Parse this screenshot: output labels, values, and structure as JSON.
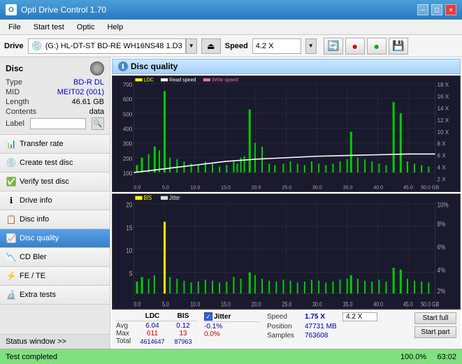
{
  "titlebar": {
    "title": "Opti Drive Control 1.70",
    "minimize": "—",
    "maximize": "□",
    "close": "✕"
  },
  "menubar": {
    "items": [
      "File",
      "Start test",
      "Optic",
      "Help"
    ]
  },
  "drivebar": {
    "label": "Drive",
    "drive_name": "(G:)  HL-DT-ST BD-RE  WH16NS48 1.D3",
    "speed_label": "Speed",
    "speed_value": "4.2 X"
  },
  "disc": {
    "label": "Disc",
    "type_key": "Type",
    "type_val": "BD-R DL",
    "mid_key": "MID",
    "mid_val": "MEIT02 (001)",
    "length_key": "Length",
    "length_val": "46.61 GB",
    "contents_key": "Contents",
    "contents_val": "data",
    "label_key": "Label",
    "label_val": ""
  },
  "nav": {
    "items": [
      "Transfer rate",
      "Create test disc",
      "Verify test disc",
      "Drive info",
      "Disc info",
      "Disc quality",
      "CD Bler",
      "FE / TE",
      "Extra tests"
    ],
    "active": "Disc quality"
  },
  "status_window": "Status window >>",
  "chart": {
    "title": "Disc quality",
    "legend": {
      "ldc": "LDC",
      "read_speed": "Read speed",
      "write_speed": "Write speed",
      "bis": "BIS",
      "jitter": "Jitter"
    },
    "top_chart": {
      "y_max": 700,
      "y_labels": [
        "700",
        "600",
        "500",
        "400",
        "300",
        "200",
        "100"
      ],
      "y_right_labels": [
        "18 X",
        "16 X",
        "14 X",
        "12 X",
        "10 X",
        "8 X",
        "6 X",
        "4 X",
        "2 X"
      ],
      "x_labels": [
        "0.0",
        "5.0",
        "10.0",
        "15.0",
        "20.0",
        "25.0",
        "30.0",
        "35.0",
        "40.0",
        "45.0",
        "50.0 GB"
      ]
    },
    "bottom_chart": {
      "y_labels": [
        "20",
        "15",
        "10",
        "5"
      ],
      "y_right_labels": [
        "10%",
        "8%",
        "6%",
        "4%",
        "2%"
      ],
      "x_labels": [
        "0.0",
        "5.0",
        "10.0",
        "15.0",
        "20.0",
        "25.0",
        "30.0",
        "35.0",
        "40.0",
        "45.0",
        "50.0 GB"
      ]
    }
  },
  "stats": {
    "ldc_header": "LDC",
    "bis_header": "BIS",
    "jitter_header": "Jitter",
    "avg_label": "Avg",
    "max_label": "Max",
    "total_label": "Total",
    "ldc_avg": "6.04",
    "ldc_max": "611",
    "ldc_total": "4614647",
    "bis_avg": "0.12",
    "bis_max": "13",
    "bis_total": "87963",
    "jitter_avg": "-0.1%",
    "jitter_max": "0.0%",
    "speed_label": "Speed",
    "speed_val": "1.75 X",
    "speed_select": "4.2 X",
    "position_label": "Position",
    "position_val": "47731 MB",
    "samples_label": "Samples",
    "samples_val": "763608",
    "start_full": "Start full",
    "start_part": "Start part"
  },
  "progress": {
    "text": "Test completed",
    "percent": 100.0,
    "percent_text": "100.0%",
    "time": "63:02"
  }
}
